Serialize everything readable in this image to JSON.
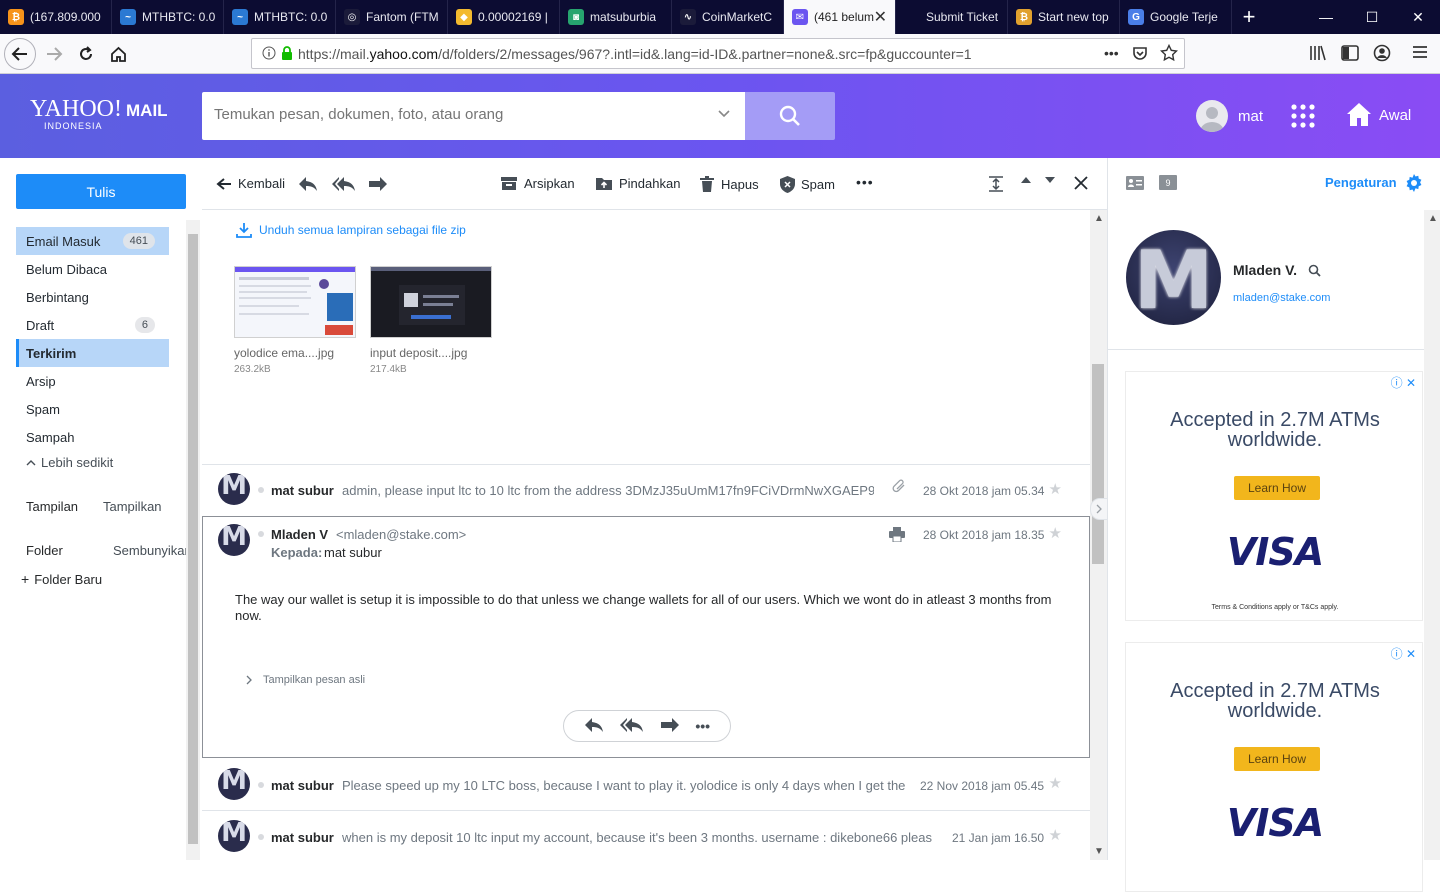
{
  "browser": {
    "tabs": [
      {
        "title": "(167.809.000 ",
        "favicon_color": "#f7931a",
        "favicon_glyph": "₿"
      },
      {
        "title": "MTHBTC: 0.0",
        "favicon_color": "#2b79d3",
        "favicon_glyph": "~"
      },
      {
        "title": "MTHBTC: 0.0",
        "favicon_color": "#2b79d3",
        "favicon_glyph": "~"
      },
      {
        "title": "Fantom (FTM",
        "favicon_color": "#1b1b3a",
        "favicon_glyph": "◎"
      },
      {
        "title": "0.00002169 |",
        "favicon_color": "#f3ba2f",
        "favicon_glyph": "◆"
      },
      {
        "title": "matsuburbia",
        "favicon_color": "#27a46f",
        "favicon_glyph": "◙"
      },
      {
        "title": "CoinMarketC",
        "favicon_color": "#1b1b3a",
        "favicon_glyph": "∿"
      },
      {
        "title": "(461 belum",
        "favicon_color": "#6b55f0",
        "favicon_glyph": "✉",
        "active": true
      },
      {
        "title": "Submit Ticket - V",
        "favicon_color": "#0c0c32",
        "favicon_glyph": ""
      },
      {
        "title": "Start new top",
        "favicon_color": "#e1a12e",
        "favicon_glyph": "₿"
      },
      {
        "title": "Google Terje",
        "favicon_color": "#4a7ee8",
        "favicon_glyph": "G"
      }
    ],
    "new_tab": "+",
    "url": "https://mail.yahoo.com/d/folders/2/messages/967?.intl=id&.lang=id-ID&.partner=none&.src=fp&guccounter=1",
    "url_domain": "yahoo.com",
    "url_prefix": "https://mail.",
    "url_suffix": "/d/folders/2/messages/967?.intl=id&.lang=id-ID&.partner=none&.src=fp&guccounter=1",
    "url_more": "•••"
  },
  "header": {
    "logo_text": "YAHOO!",
    "logo_mail": "MAIL",
    "logo_region": "INDONESIA",
    "search_placeholder": "Temukan pesan, dokumen, foto, atau orang",
    "user_name": "mat",
    "home_label": "Awal",
    "brand_color": "#6b55f0"
  },
  "sidebar": {
    "compose": "Tulis",
    "folders": [
      {
        "label": "Email Masuk",
        "count": "461"
      },
      {
        "label": "Belum Dibaca",
        "count": ""
      },
      {
        "label": "Berbintang",
        "count": ""
      },
      {
        "label": "Draft",
        "count": "6"
      },
      {
        "label": "Terkirim",
        "count": ""
      },
      {
        "label": "Arsip",
        "count": ""
      },
      {
        "label": "Spam",
        "count": ""
      },
      {
        "label": "Sampah",
        "count": ""
      }
    ],
    "less": "Lebih sedikit",
    "views_label": "Tampilan",
    "views_toggle": "Tampilkan",
    "folder_label": "Folder",
    "folder_toggle": "Sembunyikan",
    "new_folder": "Folder Baru"
  },
  "toolbar": {
    "back": "Kembali",
    "archive": "Arsipkan",
    "move": "Pindahkan",
    "delete": "Hapus",
    "spam": "Spam",
    "more": "•••"
  },
  "attachments": {
    "download_all": "Unduh semua lampiran sebagai file zip",
    "files": [
      {
        "name": "yolodice ema....jpg",
        "size": "263.2kB"
      },
      {
        "name": "input deposit....jpg",
        "size": "217.4kB"
      }
    ]
  },
  "thread": [
    {
      "sender": "mat subur",
      "snippet": "admin, please input ltc to 10 ltc from the address 3DMzJ35uUmM17fn9FCiVDrmNwXGAEP9",
      "date": "28 Okt 2018 jam 05.34"
    },
    {
      "sender": "mat subur",
      "snippet": "Please speed up my 10 LTC boss, because I want to play it. yolodice is only 4 days when I get the",
      "date": "22 Nov 2018 jam 05.45"
    },
    {
      "sender": "mat subur",
      "snippet": "when is my deposit 10 ltc input my account, because it's been 3 months. username : dikebone66 pleas",
      "date": "21 Jan jam 16.50"
    }
  ],
  "open_message": {
    "sender": "Mladen V",
    "email": "<mladen@stake.com>",
    "to_label": "Kepada:",
    "to": "mat subur",
    "date": "28 Okt 2018 jam 18.35",
    "body": "The way our wallet is setup it is impossible to do that unless we change wallets for all of our users. Which we wont do in atleast 3 months from now.",
    "show_original": "Tampilkan pesan asli"
  },
  "right_panel": {
    "settings": "Pengaturan",
    "calendar_day": "9",
    "contact_name": "Mladen V.",
    "contact_email": "mladen@stake.com",
    "ads": [
      {
        "headline": "Accepted in 2.7M ATMs worldwide.",
        "cta": "Learn How",
        "brand": "VISA",
        "terms": "Terms & Conditions apply or T&Cs apply."
      },
      {
        "headline": "Accepted in 2.7M ATMs worldwide.",
        "cta": "Learn How",
        "brand": "VISA",
        "terms": ""
      }
    ]
  }
}
